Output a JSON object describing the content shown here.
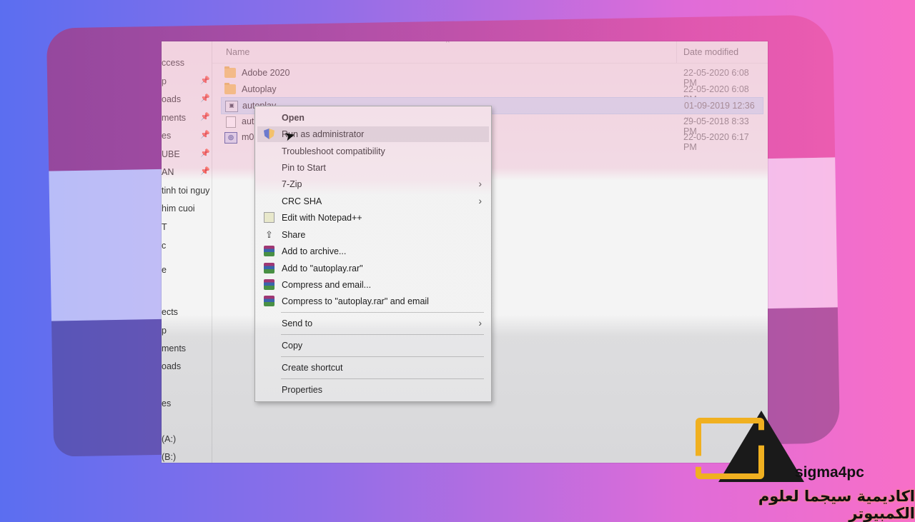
{
  "nav": {
    "items": [
      {
        "label": "ccess",
        "pinned": false
      },
      {
        "label": "p",
        "pinned": true
      },
      {
        "label": "oads",
        "pinned": true
      },
      {
        "label": "ments",
        "pinned": true
      },
      {
        "label": "es",
        "pinned": true
      },
      {
        "label": "UBE",
        "pinned": true
      },
      {
        "label": "AN",
        "pinned": true
      },
      {
        "label": "tinh toi nguy",
        "pinned": false
      },
      {
        "label": "him cuoi",
        "pinned": false
      },
      {
        "label": "T",
        "pinned": false
      },
      {
        "label": "c",
        "pinned": false
      },
      {
        "label": "e",
        "pinned": false
      },
      {
        "label": "ects",
        "pinned": false
      },
      {
        "label": "p",
        "pinned": false
      },
      {
        "label": "ments",
        "pinned": false
      },
      {
        "label": "oads",
        "pinned": false
      },
      {
        "label": "es",
        "pinned": false
      },
      {
        "label": "(A:)",
        "pinned": false
      },
      {
        "label": "(B:)",
        "pinned": false
      }
    ]
  },
  "columns": {
    "name": "Name",
    "date_modified": "Date modified"
  },
  "files": [
    {
      "name": "Adobe 2020",
      "date": "22-05-2020 6:08 PM",
      "icon": "folder-icon"
    },
    {
      "name": "Autoplay",
      "date": "22-05-2020 6:08 PM",
      "icon": "folder-icon"
    },
    {
      "name": "autoplay",
      "date": "01-09-2019 12:36 ...",
      "icon": "application-icon",
      "selected": true
    },
    {
      "name": "aut",
      "date": "29-05-2018 8:33 PM",
      "icon": "document-icon"
    },
    {
      "name": "m0",
      "date": "22-05-2020 6:17 PM",
      "icon": "installer-icon"
    }
  ],
  "context_menu": {
    "items": [
      {
        "label": "Open",
        "bold": true
      },
      {
        "label": "Run as administrator",
        "icon": "uac-shield-icon",
        "hover": true
      },
      {
        "label": "Troubleshoot compatibility"
      },
      {
        "label": "Pin to Start"
      },
      {
        "label": "7-Zip",
        "submenu": true
      },
      {
        "label": "CRC SHA",
        "submenu": true
      },
      {
        "label": "Edit with Notepad++",
        "icon": "notepad-icon"
      },
      {
        "label": "Share",
        "icon": "share-icon"
      },
      {
        "label": "Add to archive...",
        "icon": "winrar-icon"
      },
      {
        "label": "Add to \"autoplay.rar\"",
        "icon": "winrar-icon"
      },
      {
        "label": "Compress and email...",
        "icon": "winrar-icon"
      },
      {
        "label": "Compress to \"autoplay.rar\" and email",
        "icon": "winrar-icon"
      },
      {
        "label": "Send to",
        "submenu": true
      },
      {
        "label": "Copy"
      },
      {
        "label": "Create shortcut"
      },
      {
        "label": "Properties"
      }
    ]
  },
  "watermark": {
    "brand": "sigma4pc",
    "arabic": "اكاديمية سيجما لعلوم الكمبيوتر",
    "colors": {
      "gold": "#f0b020",
      "dark": "#1a1a1a"
    }
  }
}
